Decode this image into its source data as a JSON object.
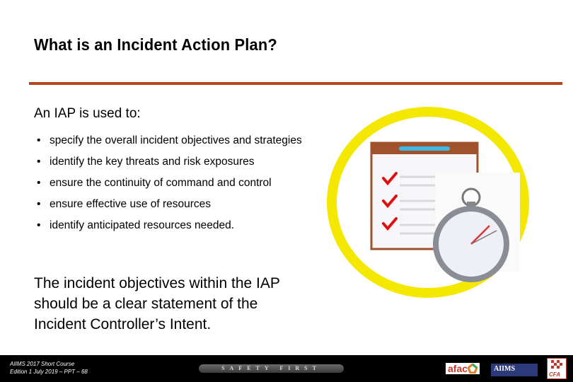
{
  "slide": {
    "title": "What is an Incident Action Plan?",
    "lead": "An IAP is used to:",
    "bullet_symbol": "•",
    "bullets": [
      "specify the overall incident objectives and strategies",
      "identify the key threats and risk exposures",
      "ensure the continuity of command and control",
      "ensure effective use of resources",
      "identify anticipated resources needed."
    ],
    "closing": "The incident objectives within the IAP should be a clear statement of the Incident Controller’s Intent.",
    "illustration": {
      "icons": [
        "checklist-icon",
        "stopwatch-icon"
      ],
      "ring_color": "#f5e800"
    },
    "accent_color": "#b5451b"
  },
  "footer": {
    "course": "AIIMS 2017 Short Course",
    "edition": "Edition 1 July 2019 – PPT – 68",
    "banner": "SAFETY FIRST",
    "logos": {
      "afac": "afac",
      "aiims": "AIIMS",
      "cfa": "CFA"
    }
  }
}
